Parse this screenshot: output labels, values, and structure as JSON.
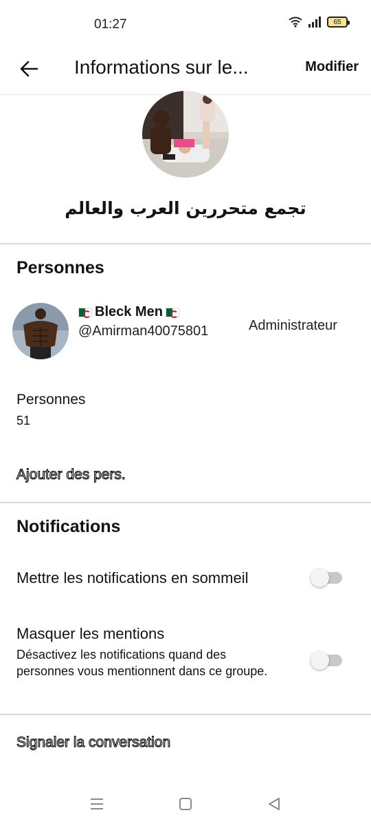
{
  "status_bar": {
    "time": "01:27",
    "battery": "65",
    "icons": [
      "wifi-icon",
      "signal-icon",
      "battery-icon"
    ]
  },
  "header": {
    "title": "Informations sur le...",
    "modify_label": "Modifier",
    "back_icon": "arrow-left-icon"
  },
  "group": {
    "name": "تجمع متحررين العرب والعالم"
  },
  "people_section": {
    "title": "Personnes",
    "member": {
      "display_name": "Bleck Men",
      "handle": "@Amirman40075801",
      "role": "Administrateur"
    },
    "count_label": "Personnes",
    "count": "51",
    "add_people": "Ajouter des pers."
  },
  "notifications_section": {
    "title": "Notifications",
    "snooze_label": "Mettre les notifications en sommeil",
    "snooze_enabled": false,
    "mentions_label": "Masquer les mentions",
    "mentions_desc": "Désactivez les notifications quand des personnes vous mentionnent dans ce groupe.",
    "mentions_enabled": false
  },
  "report_conversation": "Signaler la conversation",
  "nav_bar": {
    "icons": [
      "menu-icon",
      "home-square-icon",
      "back-triangle-icon"
    ]
  },
  "colors": {
    "text": "#0f1419",
    "divider": "#d9d9d9",
    "toggle_off_track": "#c8c8c8"
  }
}
